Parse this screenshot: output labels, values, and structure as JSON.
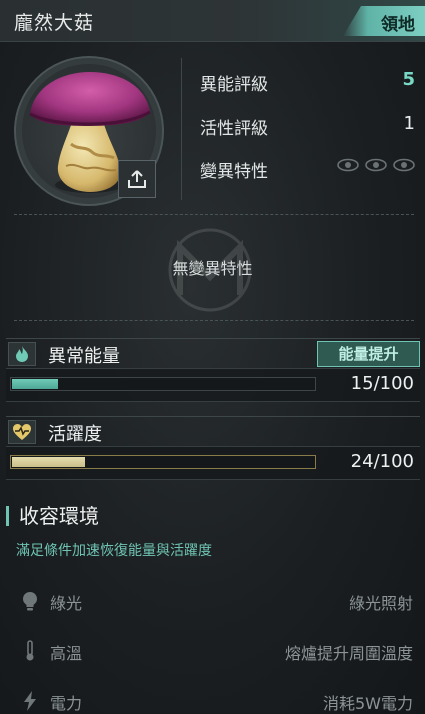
{
  "header": {
    "title": "龐然大菇",
    "tag": "領地",
    "accent": "#7ccfc1"
  },
  "portrait": {
    "subject": "mushroom",
    "icons": [
      "upload-icon"
    ]
  },
  "stats": {
    "rating_label": "異能評級",
    "rating_value": "5",
    "activity_label": "活性評級",
    "activity_value": "1",
    "mutation_label": "變異特性",
    "mutation_icons": [
      "eye-icon",
      "eye-icon",
      "eye-icon"
    ]
  },
  "mutation": {
    "empty_text": "無變異特性"
  },
  "energy": {
    "title": "異常能量",
    "boost_label": "能量提升",
    "value_text": "15/100",
    "fraction": 0.15,
    "color": "#6fcab6"
  },
  "vitality": {
    "title": "活躍度",
    "value_text": "24/100",
    "fraction": 0.24,
    "color": "#e5dcae"
  },
  "containment": {
    "title": "收容環境",
    "subtitle": "滿足條件加速恢復能量與活躍度",
    "rows": [
      {
        "icon": "bulb-icon",
        "label": "綠光",
        "value": "綠光照射"
      },
      {
        "icon": "thermometer-icon",
        "label": "高溫",
        "value": "熔爐提升周圍溫度"
      },
      {
        "icon": "lightning-icon",
        "label": "電力",
        "value": "消耗5W電力"
      }
    ]
  }
}
